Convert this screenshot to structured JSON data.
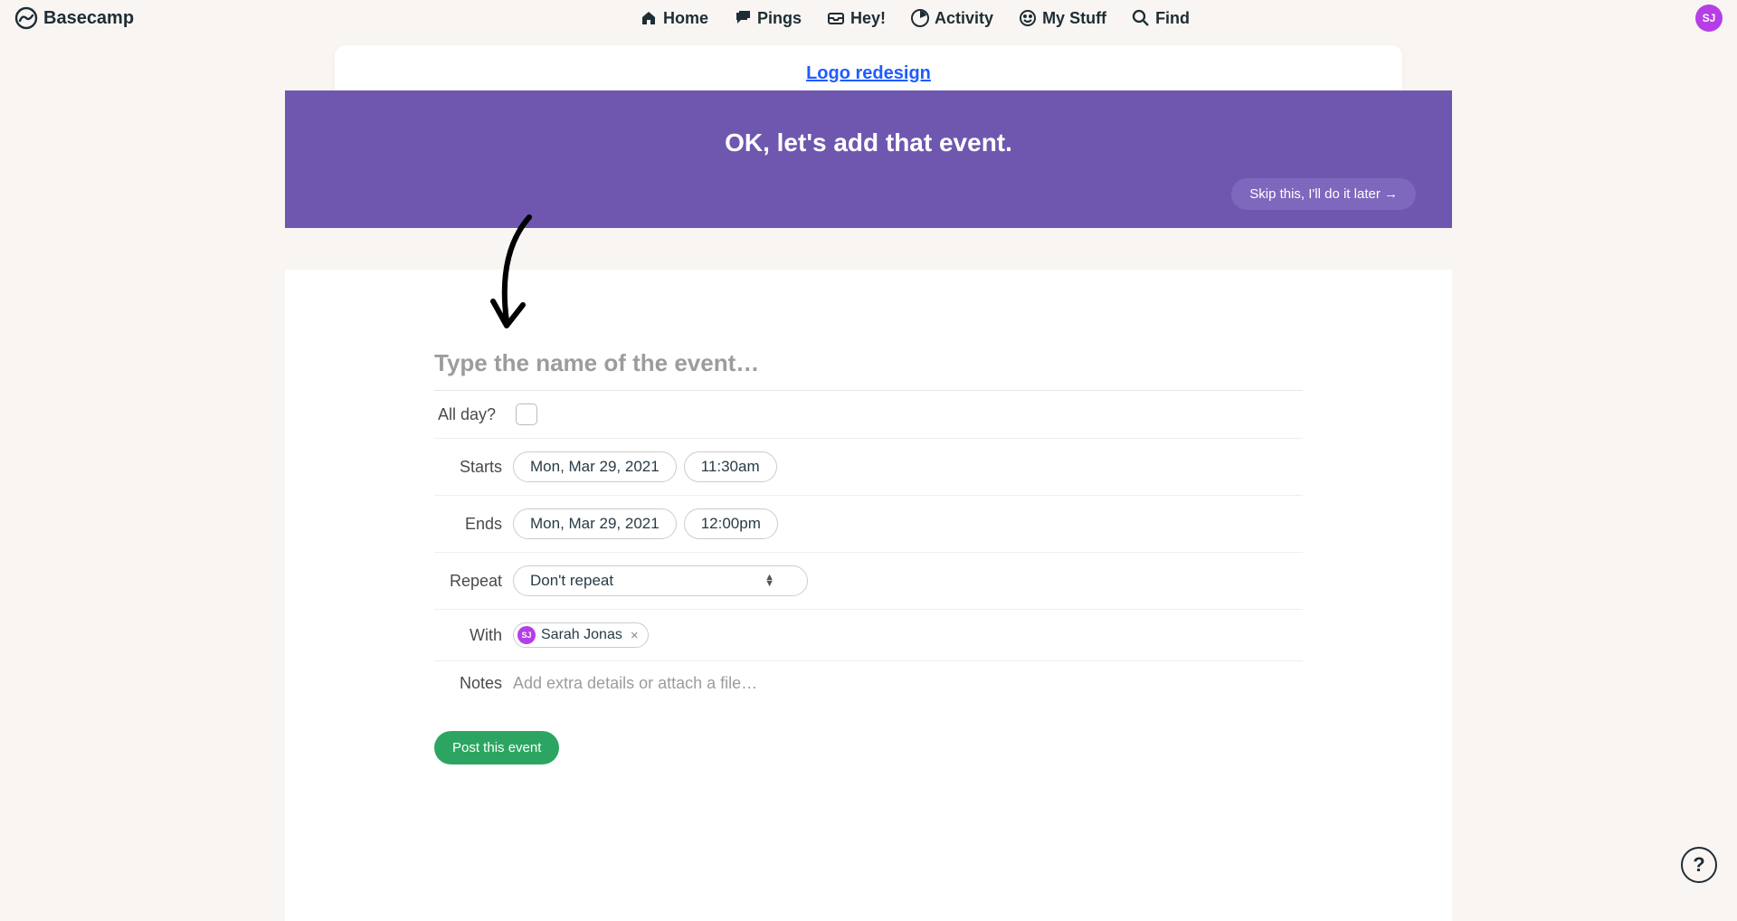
{
  "brand": "Basecamp",
  "nav": {
    "home": "Home",
    "pings": "Pings",
    "hey": "Hey!",
    "activity": "Activity",
    "mystuff": "My Stuff",
    "find": "Find"
  },
  "avatar_initials": "SJ",
  "project_link": "Logo redesign",
  "banner": {
    "title": "OK, let's add that event.",
    "skip": "Skip this, I'll do it later →"
  },
  "form": {
    "name_placeholder": "Type the name of the event…",
    "allday_label": "All day?",
    "starts_label": "Starts",
    "starts_date": "Mon, Mar 29, 2021",
    "starts_time": "11:30am",
    "ends_label": "Ends",
    "ends_date": "Mon, Mar 29, 2021",
    "ends_time": "12:00pm",
    "repeat_label": "Repeat",
    "repeat_value": "Don't repeat",
    "with_label": "With",
    "with_chip_initials": "SJ",
    "with_chip_name": "Sarah Jonas",
    "with_chip_remove": "×",
    "notes_label": "Notes",
    "notes_placeholder": "Add extra details or attach a file…",
    "submit": "Post this event"
  },
  "help_label": "?"
}
